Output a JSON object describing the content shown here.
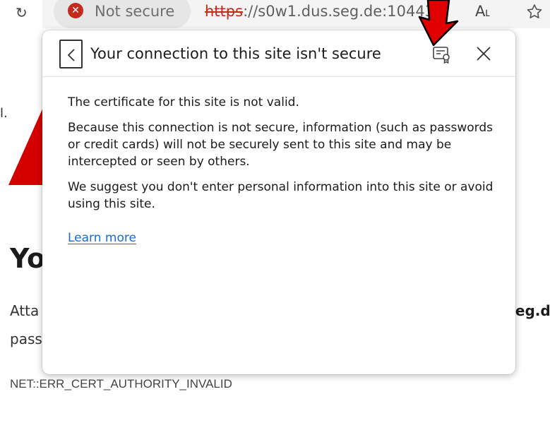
{
  "browser": {
    "security_chip_label": "Not secure",
    "url_scheme": "https",
    "url_rest": "://s0w1.dus.seg.de:10443",
    "read_aloud_label": "A˪",
    "icons": [
      "reload-icon",
      "error-x-icon",
      "favorite-star-icon"
    ]
  },
  "background_page": {
    "heading_partial": "Yo",
    "attack_text_partial": "Atta",
    "host_partial": "seg.d",
    "pass_partial": "pass",
    "error_code": "NET::ERR_CERT_AUTHORITY_INVALID",
    "fragment_char": "l.",
    "warning_color": "#d40000"
  },
  "popup": {
    "title": "Your connection to this site isn't secure",
    "paragraph1": "The certificate for this site is not valid.",
    "paragraph2": "Because this connection is not secure, information (such as passwords or credit cards) will not be securely sent to this site and may be intercepted or seen by others.",
    "paragraph3": "We suggest you don't enter personal information into this site or avoid using this site.",
    "learn_more": "Learn more",
    "icons": [
      "back-chevron-icon",
      "certificate-icon",
      "close-icon"
    ],
    "link_color": "#1a6ccf"
  },
  "annotation": {
    "arrow_color": "#e00000",
    "points_to": "certificate-icon"
  }
}
